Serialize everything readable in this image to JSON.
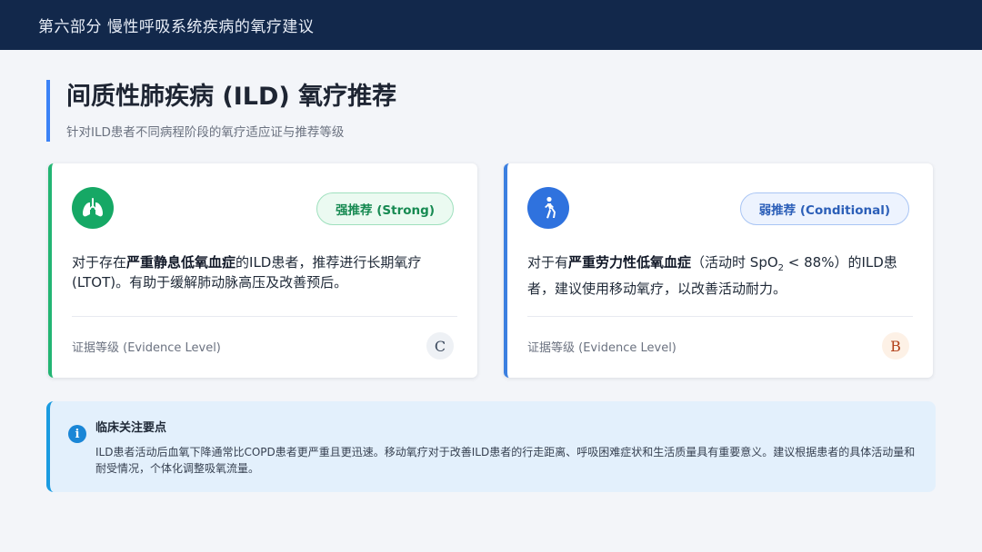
{
  "header": {
    "section_title": "第六部分 慢性呼吸系统疾病的氧疗建议"
  },
  "page": {
    "title": "间质性肺疾病 (ILD) 氧疗推荐",
    "subtitle": "针对ILD患者不同病程阶段的氧疗适应证与推荐等级"
  },
  "cards": [
    {
      "icon": "lungs-icon",
      "badge": "强推荐 (Strong)",
      "text_prefix": "对于存在",
      "text_bold": "严重静息低氧血症",
      "text_suffix": "的ILD患者，推荐进行长期氧疗 (LTOT)。有助于缓解肺动脉高压及改善预后。",
      "evidence_label": "证据等级 (Evidence Level)",
      "grade": "C",
      "accent": "#22b573"
    },
    {
      "icon": "walking-person-icon",
      "badge": "弱推荐 (Conditional)",
      "text_prefix": "对于有",
      "text_bold": "严重劳力性低氧血症",
      "text_mid": "（活动时 SpO",
      "text_sub": "2",
      "text_suffix": " < 88%）的ILD患者，建议使用移动氧疗，以改善活动耐力。",
      "evidence_label": "证据等级 (Evidence Level)",
      "grade": "B",
      "accent": "#3b7fe0"
    }
  ],
  "note": {
    "icon": "info-icon",
    "title": "临床关注要点",
    "text": "ILD患者活动后血氧下降通常比COPD患者更严重且更迅速。移动氧疗对于改善ILD患者的行走距离、呼吸困难症状和生活质量具有重要意义。建议根据患者的具体活动量和耐受情况，个体化调整吸氧流量。"
  }
}
